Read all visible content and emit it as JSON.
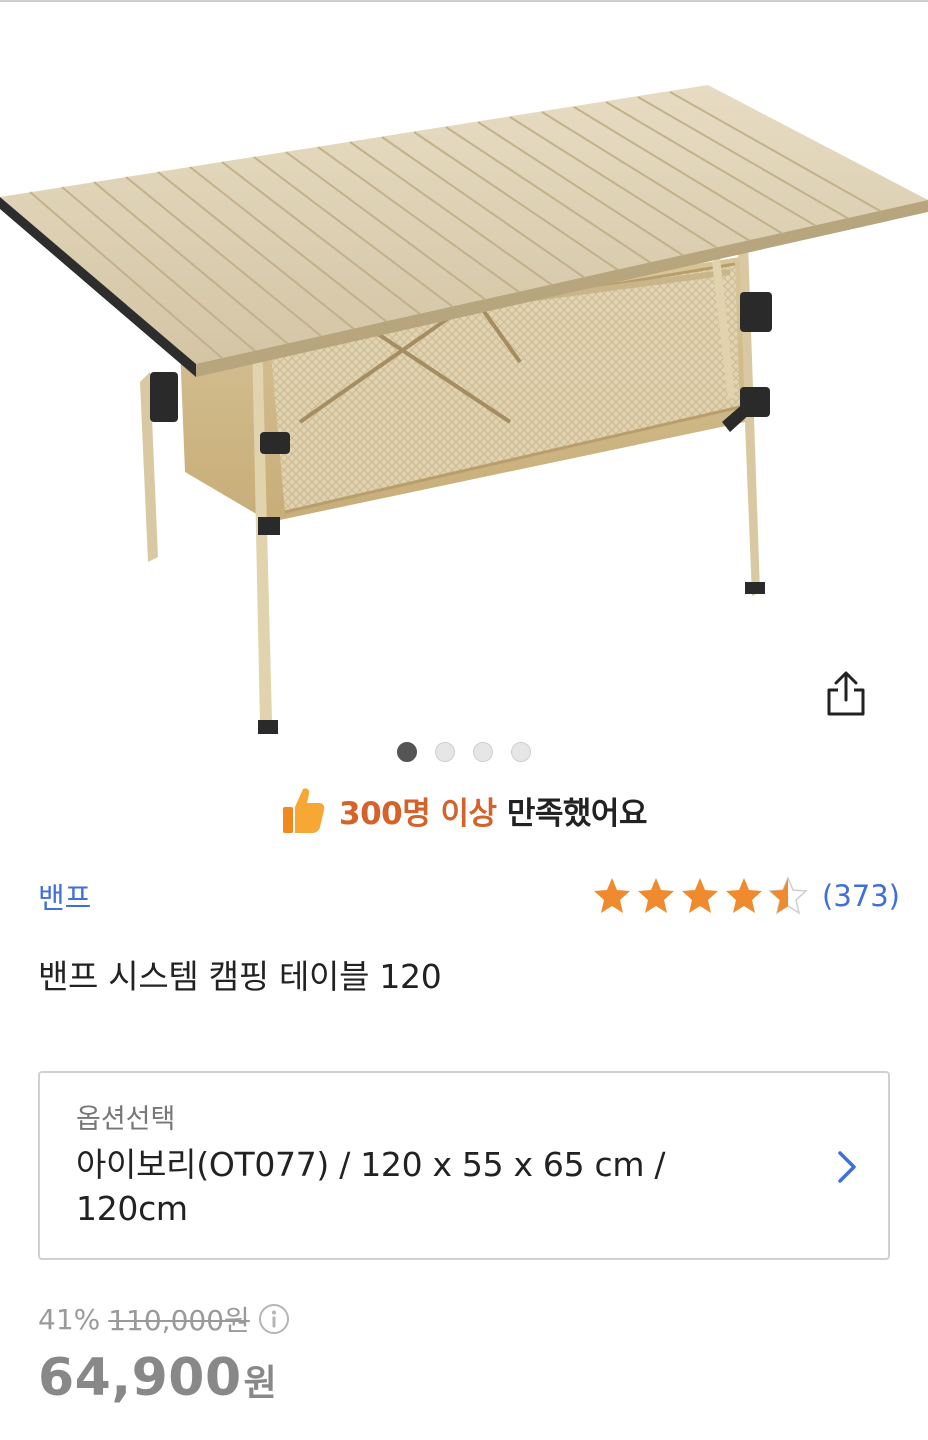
{
  "hero": {
    "image_name": "camping-table-product-photo",
    "carousel_count": 4,
    "carousel_active_index": 0
  },
  "icons": {
    "share": "share-icon",
    "thumbs_up": "thumbs-up-icon",
    "star": "star-icon",
    "chevron": "chevron-right-icon",
    "info": "info-icon"
  },
  "satisfaction": {
    "highlight": "300명 이상",
    "rest": "만족했어요"
  },
  "product": {
    "brand": "밴프",
    "title": "밴프 시스템 캠핑 테이블 120",
    "rating": 4.5,
    "rating_count": "(373)"
  },
  "option": {
    "label": "옵션선택",
    "value": "아이보리(OT077) / 120 x 55 x 65 cm / 120cm"
  },
  "price": {
    "discount": "41%",
    "original": "110,000원",
    "sale_number": "64,900",
    "sale_unit": "원"
  },
  "colors": {
    "accent_blue": "#3f6fd8",
    "highlight_orange": "#d4622a",
    "star_orange": "#f08a2e",
    "price_gray": "#888888"
  }
}
